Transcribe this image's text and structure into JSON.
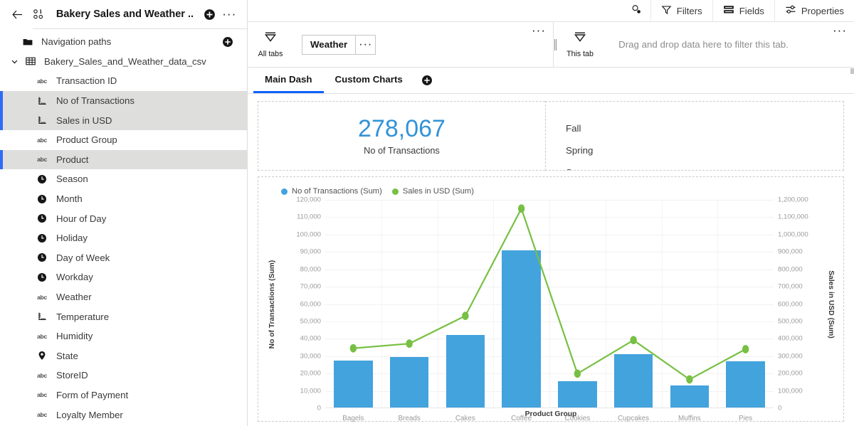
{
  "sidebar": {
    "header": {
      "title": "Bakery Sales and Weather ...",
      "back_icon": "back-arrow-icon",
      "binary_icon": "binary-icon",
      "add_icon": "add-icon",
      "more_icon": "overflow-menu-icon"
    },
    "nav_paths": {
      "label": "Navigation paths",
      "icon": "folder-icon",
      "add_icon": "add-icon"
    },
    "dataset": {
      "label": "Bakery_Sales_and_Weather_data_csv",
      "icon": "table-icon",
      "chevron": "chevron-down-icon"
    },
    "fields": [
      {
        "label": "Transaction ID",
        "type": "abc",
        "selected": false
      },
      {
        "label": "No of Transactions",
        "type": "measure",
        "selected": true
      },
      {
        "label": "Sales in USD",
        "type": "measure",
        "selected": true
      },
      {
        "label": "Product Group",
        "type": "abc",
        "selected": false
      },
      {
        "label": "Product",
        "type": "abc",
        "selected": true
      },
      {
        "label": "Season",
        "type": "time",
        "selected": false
      },
      {
        "label": "Month",
        "type": "time",
        "selected": false
      },
      {
        "label": "Hour of Day",
        "type": "time",
        "selected": false
      },
      {
        "label": "Holiday",
        "type": "time",
        "selected": false
      },
      {
        "label": "Day of Week",
        "type": "time",
        "selected": false
      },
      {
        "label": "Workday",
        "type": "time",
        "selected": false
      },
      {
        "label": "Weather",
        "type": "abc",
        "selected": false
      },
      {
        "label": "Temperature",
        "type": "measure",
        "selected": false
      },
      {
        "label": "Humidity",
        "type": "abc",
        "selected": false
      },
      {
        "label": "State",
        "type": "geo",
        "selected": false
      },
      {
        "label": "StoreID",
        "type": "abc",
        "selected": false
      },
      {
        "label": "Form of Payment",
        "type": "abc",
        "selected": false
      },
      {
        "label": "Loyalty Member",
        "type": "abc",
        "selected": false
      }
    ]
  },
  "topbar": {
    "search_label": "",
    "filters_label": "Filters",
    "fields_label": "Fields",
    "properties_label": "Properties"
  },
  "filterbar": {
    "all_tabs_label": "All tabs",
    "this_tab_label": "This tab",
    "chip_label": "Weather",
    "chip_more": "···",
    "left_more": "···",
    "right_more": "···",
    "drop_hint": "Drag and drop data here to filter this tab."
  },
  "dashtabs": {
    "tabs": [
      {
        "label": "Main Dash",
        "active": true
      },
      {
        "label": "Custom Charts",
        "active": false
      }
    ],
    "add_icon": "add-icon"
  },
  "kpi": {
    "value": "278,067",
    "label": "No of Transactions",
    "color": "#3393d6"
  },
  "list_widget": {
    "items": [
      "Fall",
      "Spring",
      "Summer"
    ]
  },
  "chart_data": {
    "type": "bar",
    "title": "",
    "xlabel": "Product Group",
    "ylabel": "No of Transactions (Sum)",
    "y2label": "Sales in USD (Sum)",
    "categories": [
      "Bagels",
      "Breads",
      "Cakes",
      "Coffee",
      "Cookies",
      "Cupcakes",
      "Muffins",
      "Pies"
    ],
    "ylim": [
      0,
      120000
    ],
    "y2lim": [
      0,
      1200000
    ],
    "yticks": [
      "0",
      "10,000",
      "20,000",
      "30,000",
      "40,000",
      "50,000",
      "60,000",
      "70,000",
      "80,000",
      "90,000",
      "100,000",
      "110,000",
      "120,000"
    ],
    "y2ticks": [
      "0",
      "100,000",
      "200,000",
      "300,000",
      "400,000",
      "500,000",
      "600,000",
      "700,000",
      "800,000",
      "900,000",
      "1,000,000",
      "1,100,000",
      "1,200,000"
    ],
    "grid": true,
    "legend": "top-left",
    "series": [
      {
        "name": "No of Transactions (Sum)",
        "type": "bar",
        "axis": "left",
        "color": "#43a3dd",
        "values": [
          27500,
          29500,
          42000,
          91000,
          15700,
          31000,
          13300,
          27000
        ]
      },
      {
        "name": "Sales in USD (Sum)",
        "type": "line",
        "axis": "right",
        "color": "#77c043",
        "values": [
          345000,
          372000,
          532000,
          1150000,
          199000,
          392000,
          166000,
          340000
        ]
      }
    ]
  }
}
